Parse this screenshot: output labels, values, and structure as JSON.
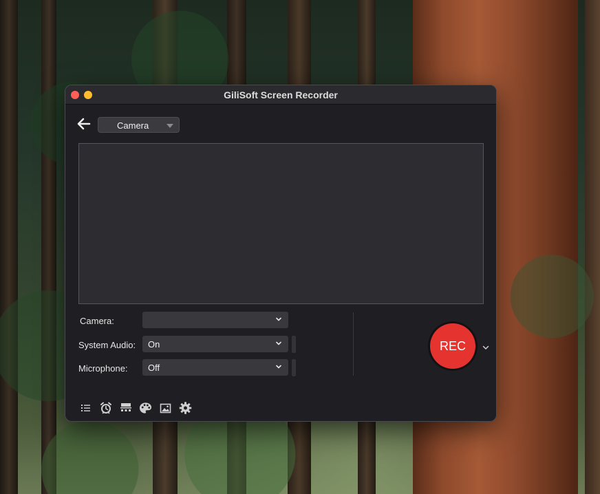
{
  "window": {
    "title": "GiliSoft Screen Recorder"
  },
  "mode": {
    "selected": "Camera"
  },
  "settings": {
    "camera": {
      "label": "Camera:",
      "value": ""
    },
    "system_audio": {
      "label": "System Audio:",
      "value": "On"
    },
    "microphone": {
      "label": "Microphone:",
      "value": "Off"
    }
  },
  "record": {
    "label": "REC",
    "color": "#e53330"
  },
  "toolbar": {
    "icons": [
      "list-icon",
      "alarm-clock-icon",
      "watermark-icon",
      "palette-icon",
      "image-icon",
      "gear-icon"
    ]
  },
  "colors": {
    "window_bg": "#1f1f23",
    "close": "#ff5f57",
    "minimize": "#febc2e"
  }
}
